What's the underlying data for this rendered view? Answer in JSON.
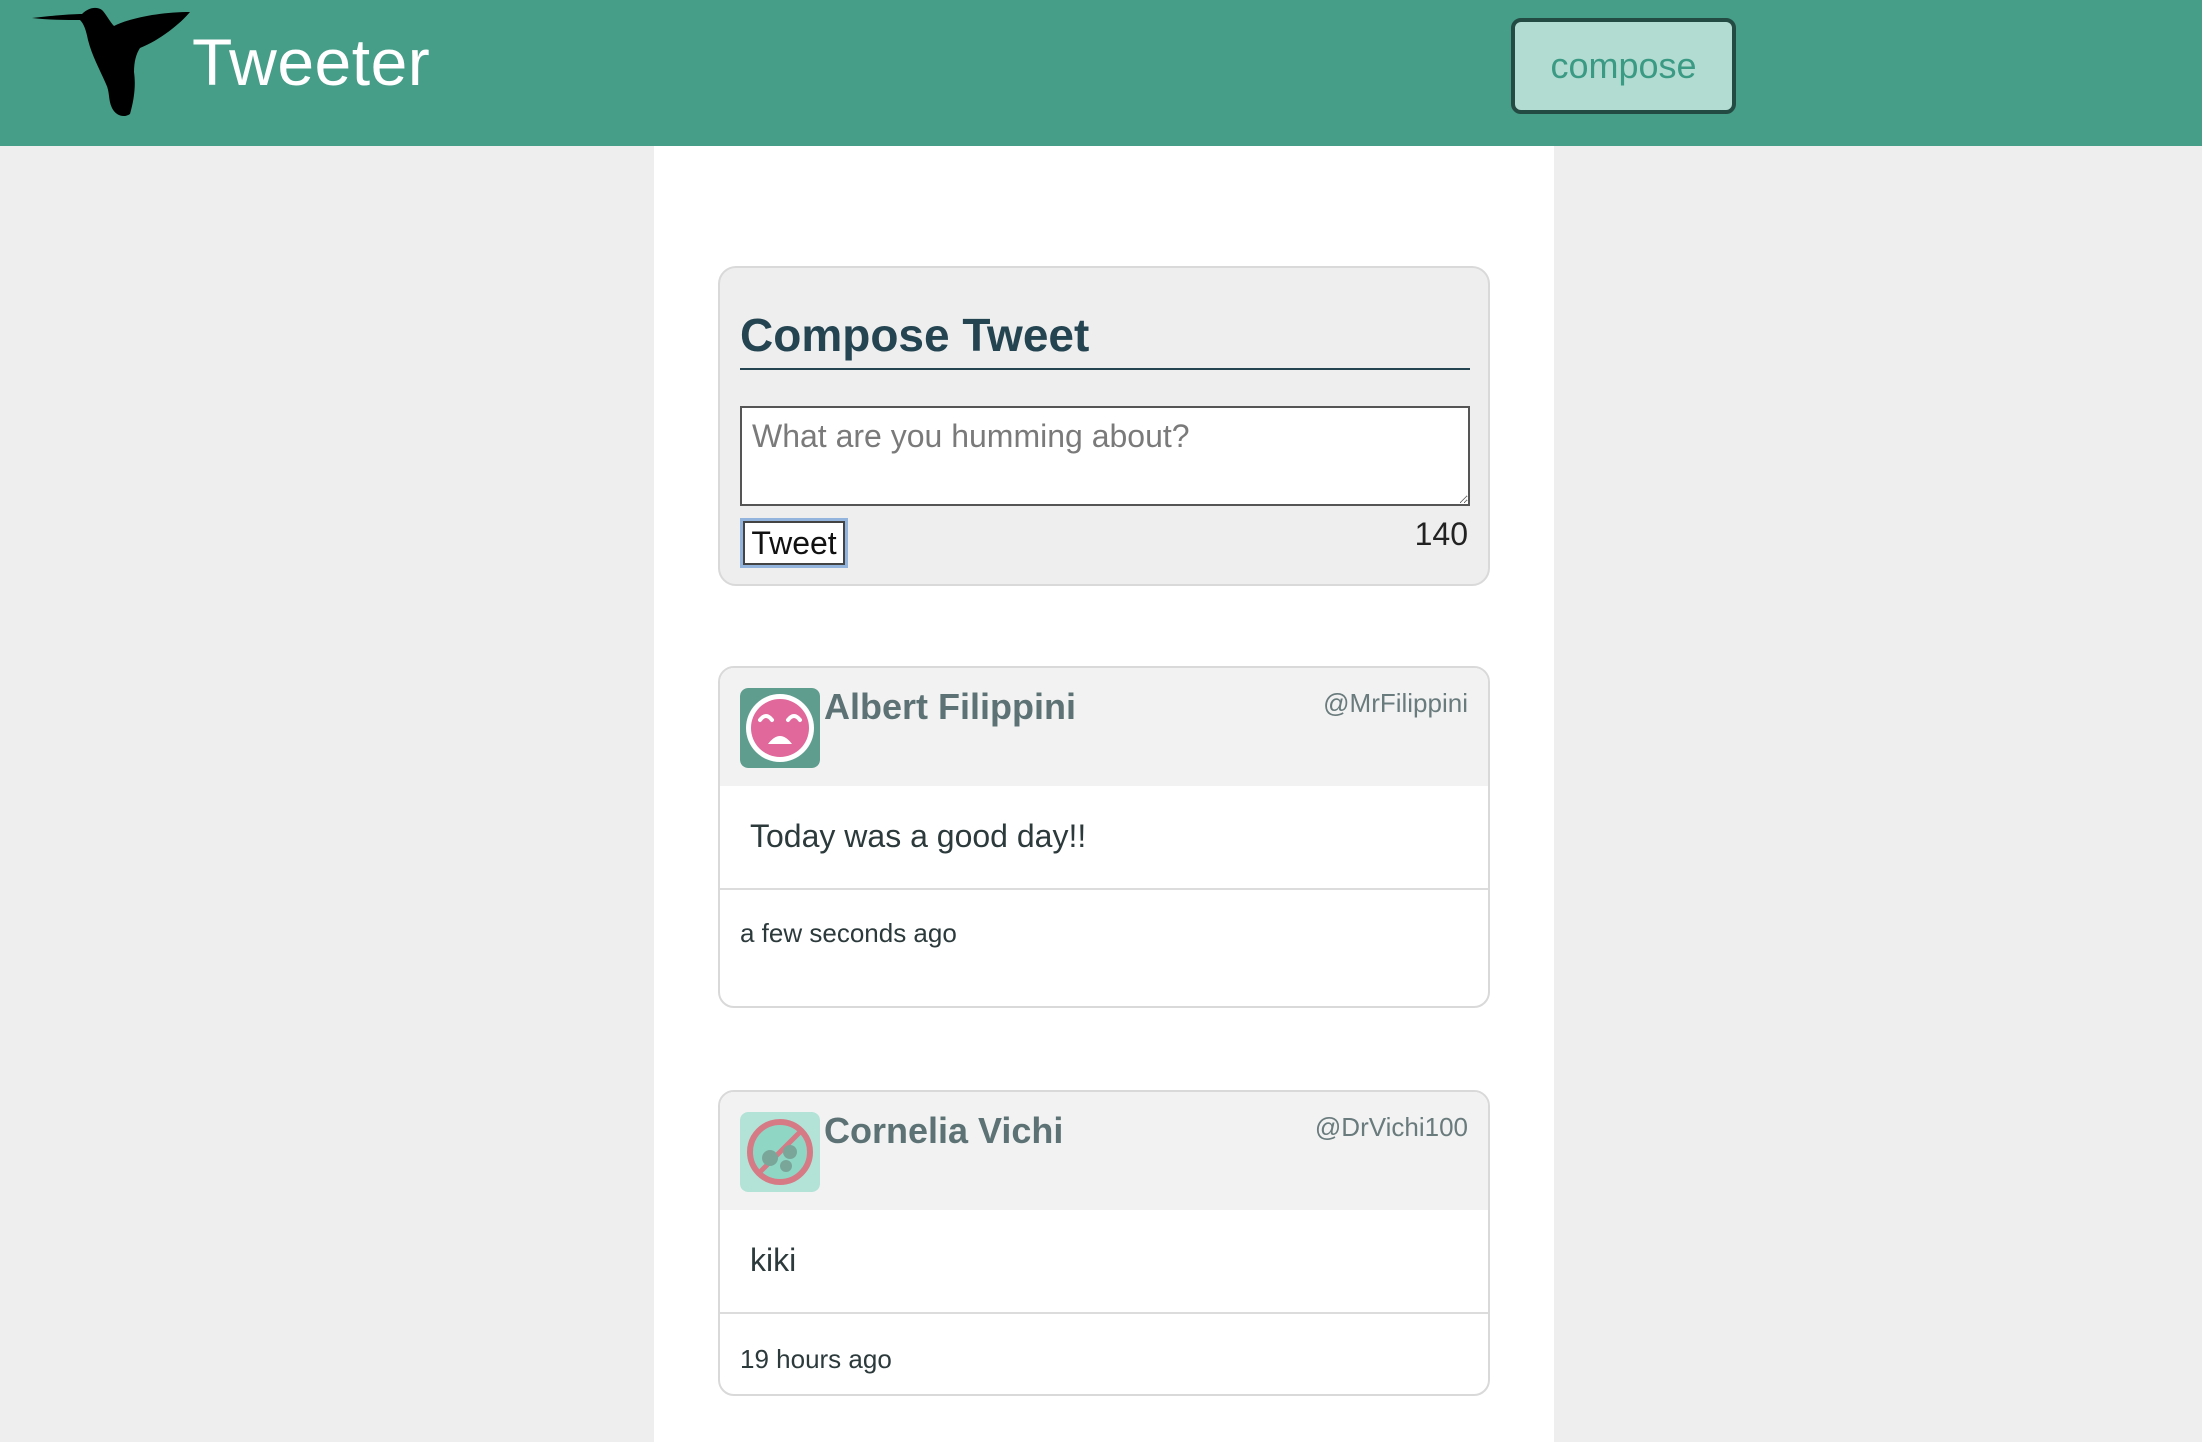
{
  "nav": {
    "brand": "Tweeter",
    "compose_label": "compose",
    "logo_icon": "hummingbird-icon"
  },
  "compose": {
    "title": "Compose Tweet",
    "placeholder": "What are you humming about?",
    "value": "",
    "tweet_label": "Tweet",
    "counter": "140"
  },
  "tweets": [
    {
      "name": "Albert Filippini",
      "handle": "@MrFilippini",
      "text": "Today was a good day!!",
      "time": "a few seconds ago",
      "avatar_icon": "pink-face-avatar-icon"
    },
    {
      "name": "Cornelia Vichi",
      "handle": "@DrVichi100",
      "text": "kiki",
      "time": "19 hours ago",
      "avatar_icon": "teal-circle-avatar-icon"
    }
  ],
  "colors": {
    "nav_bg": "#469e88",
    "compose_toggle_bg": "#b2dcd1",
    "title_text": "#244451",
    "page_bg": "#eeeeee"
  }
}
